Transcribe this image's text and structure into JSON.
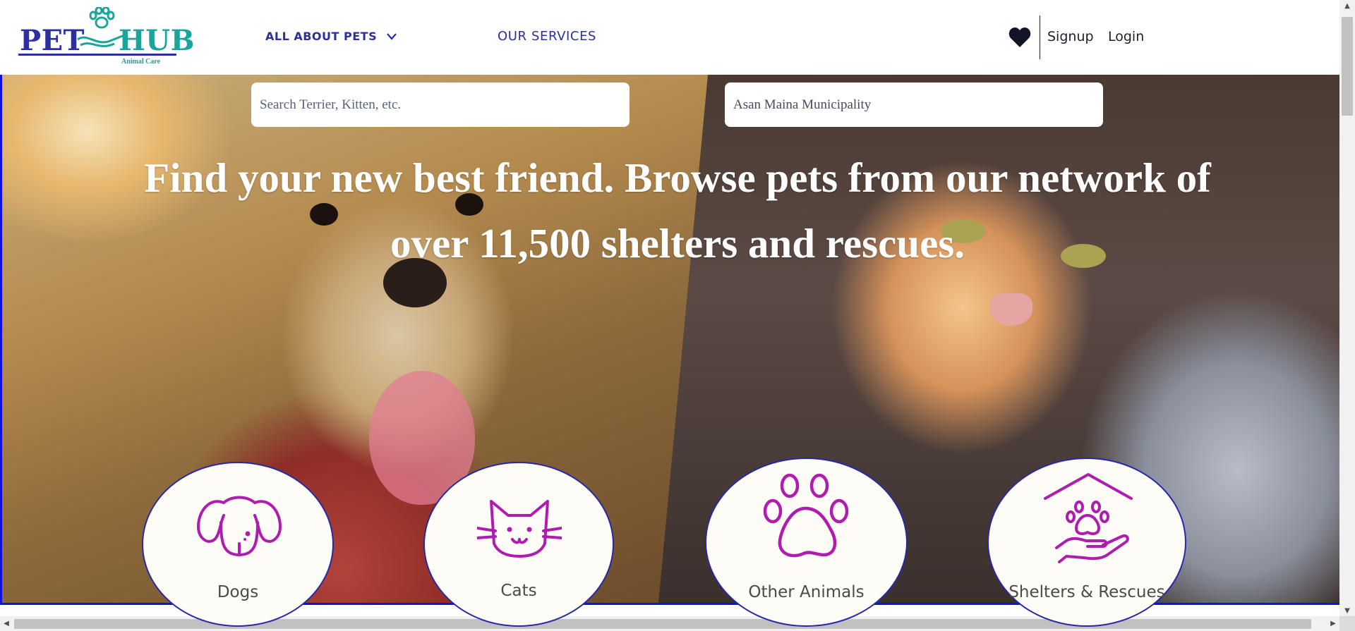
{
  "header": {
    "logo": {
      "word1": "PET",
      "word2": "HUB",
      "tagline": "Animal Care"
    },
    "nav": {
      "all_about_pets": "ALL ABOUT PETS",
      "our_services": "OUR SERVICES"
    },
    "icons": {
      "favorites": "heart-icon",
      "dropdown": "chevron-down-icon"
    },
    "signup": "Signup",
    "login": "Login"
  },
  "hero": {
    "search_pets_placeholder": "Search Terrier, Kitten, etc.",
    "location_value": "Asan Maina Municipality",
    "headline_line1": "Find your new best friend. Browse pets from our network of",
    "headline_line2": "over 11,500 shelters and rescues."
  },
  "categories": [
    {
      "label": "Dogs",
      "icon": "dog-icon"
    },
    {
      "label": "Cats",
      "icon": "cat-icon"
    },
    {
      "label": "Other Animals",
      "icon": "paw-icon"
    },
    {
      "label": "Shelters & Rescues",
      "icon": "shelter-icon"
    }
  ],
  "colors": {
    "brand_blue": "#2b2fa0",
    "brand_teal": "#1aa59a",
    "icon_magenta": "#b01bb0",
    "card_border": "#2727a8"
  }
}
